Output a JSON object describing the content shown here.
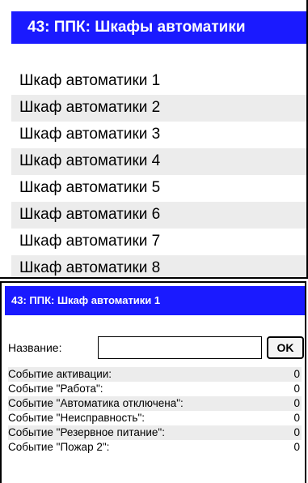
{
  "top_panel": {
    "title": "43: ППК: Шкафы автоматики",
    "items": [
      "Шкаф автоматики 1",
      "Шкаф автоматики 2",
      "Шкаф автоматики 3",
      "Шкаф автоматики 4",
      "Шкаф автоматики 5",
      "Шкаф автоматики 6",
      "Шкаф автоматики 7",
      "Шкаф автоматики 8"
    ]
  },
  "bottom_panel": {
    "title": "43: ППК: Шкаф автоматики 1",
    "name_label": "Название:",
    "name_value": "",
    "ok_label": "OK",
    "events": [
      {
        "label": "Событие активации:",
        "value": "0"
      },
      {
        "label": "Событие \"Работа\":",
        "value": "0"
      },
      {
        "label": "Событие \"Автоматика отключена\":",
        "value": "0"
      },
      {
        "label": "Событие \"Неисправность\":",
        "value": "0"
      },
      {
        "label": "Событие \"Резервное питание\":",
        "value": "0"
      },
      {
        "label": "Событие \"Пожар 2\":",
        "value": "0"
      }
    ]
  }
}
